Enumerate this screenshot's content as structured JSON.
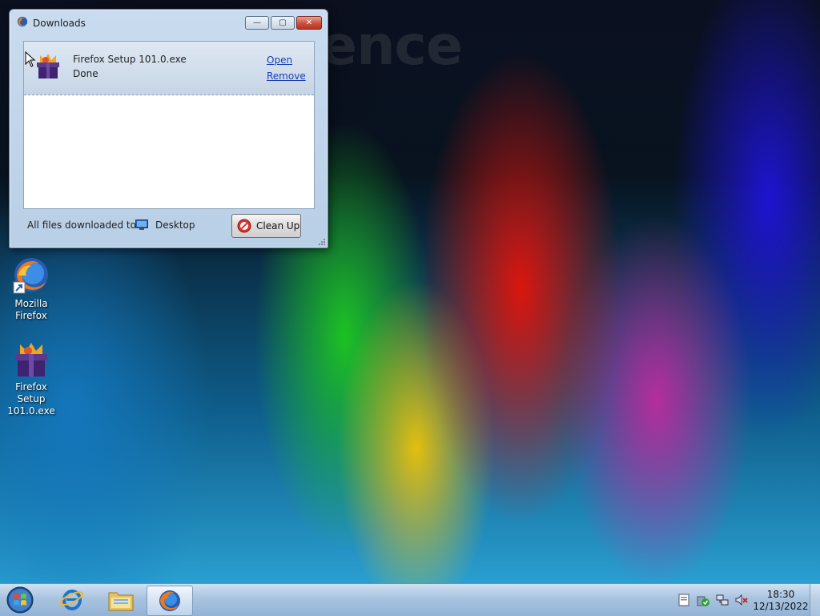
{
  "wallpaper": {
    "text": "ence"
  },
  "window": {
    "title": "Downloads",
    "controls": {
      "minimize": "—",
      "maximize": "▢",
      "close": "✕"
    },
    "download": {
      "filename": "Firefox Setup 101.0.exe",
      "status": "Done",
      "open_label": "Open",
      "remove_label": "Remove"
    },
    "footer": {
      "label": "All files downloaded to:",
      "folder": "Desktop",
      "cleanup_label": "Clean Up"
    }
  },
  "desktop_icons": [
    {
      "label_line1": "Mozilla",
      "label_line2": "Firefox",
      "icon": "firefox-icon"
    },
    {
      "label_line1": "Firefox Setup",
      "label_line2": "101.0.exe",
      "icon": "firefox-installer-icon"
    }
  ],
  "taskbar": {
    "buttons": [
      "start-orb",
      "internet-explorer",
      "windows-explorer",
      "firefox"
    ],
    "clock": {
      "time": "18:30",
      "date": "12/13/2022"
    }
  },
  "colors": {
    "link": "#1a3fb4",
    "taskbar": "#a9c3df",
    "close_button": "#c9503d"
  }
}
